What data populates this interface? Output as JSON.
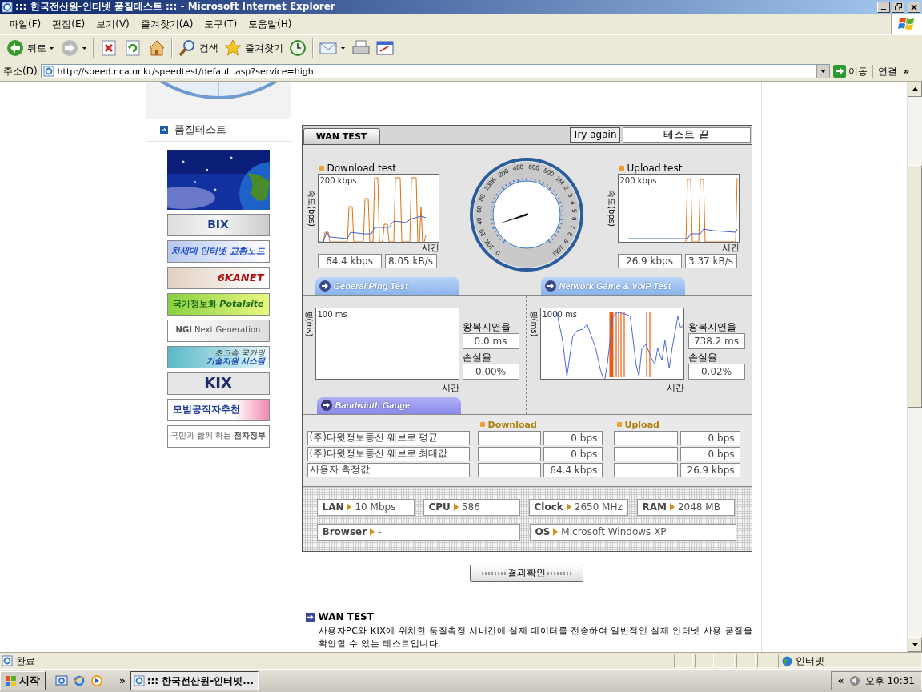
{
  "window": {
    "title": "::: 한국전산원-인터넷 품질테스트 ::: - Microsoft Internet Explorer"
  },
  "menu": [
    {
      "label": "파일(F)"
    },
    {
      "label": "편집(E)"
    },
    {
      "label": "보기(V)"
    },
    {
      "label": "즐겨찾기(A)"
    },
    {
      "label": "도구(T)"
    },
    {
      "label": "도움말(H)"
    }
  ],
  "toolbar": [
    [
      {
        "kind": "back",
        "label": "뒤로",
        "dropdown": true
      },
      {
        "kind": "forward",
        "dropdown": true
      }
    ],
    [
      {
        "kind": "stop",
        "dropdown": false
      },
      {
        "kind": "refresh",
        "dropdown": false
      },
      {
        "kind": "home",
        "dropdown": false
      }
    ],
    [
      {
        "kind": "search",
        "label": "검색",
        "dropdown": false
      },
      {
        "kind": "favorites",
        "label": "즐겨찾기",
        "dropdown": false
      },
      {
        "kind": "history",
        "dropdown": false
      }
    ],
    [
      {
        "kind": "mail",
        "dropdown": true
      },
      {
        "kind": "print",
        "dropdown": false
      },
      {
        "kind": "edit",
        "dropdown": false
      }
    ]
  ],
  "address_bar": {
    "label": "주소(D)",
    "url": "http://speed.nca.or.kr/speedtest/default.asp?service=high",
    "go": "이동",
    "links": "연결",
    "more": "»"
  },
  "sidebar": {
    "heading": "품질테스트",
    "banners": [
      {
        "kind": "picture"
      },
      {
        "kind": "banner",
        "lines": [
          "BIX"
        ]
      },
      {
        "kind": "banner",
        "lines": [
          "차세대 인터넷 교환노드"
        ]
      },
      {
        "kind": "banner",
        "lines": [
          "6KANET"
        ]
      },
      {
        "kind": "banner",
        "lines": [
          "국가정보화 *Potalsite*"
        ]
      },
      {
        "kind": "banner",
        "lines": [
          "**NGI** Next Generation"
        ]
      },
      {
        "kind": "banner",
        "lines": [
          "초고속 국가망",
          "기술지원 시스템"
        ]
      },
      {
        "kind": "banner",
        "lines": [
          "KIX"
        ]
      },
      {
        "kind": "banner",
        "lines": [
          "모범공직자추천"
        ]
      },
      {
        "kind": "banner",
        "lines": [
          "국민과 함께 하는 **전자정부**"
        ]
      }
    ]
  },
  "wan_test": {
    "tab": "WAN TEST",
    "try_again": "Try again",
    "status": "테스트 끝",
    "download": {
      "title": "Download test",
      "axis_label": "속도(bps)",
      "max_label": "200 kbps",
      "time_label": "시간",
      "readings": [
        "64.4 kbps",
        "8.05 kB/s"
      ]
    },
    "gauge": {
      "labels": [
        "0",
        "10K",
        "20",
        "40",
        "60",
        "80",
        "100K",
        "200",
        "400",
        "600",
        "800",
        "1M",
        "2",
        "3",
        "4",
        "5",
        "6",
        "7",
        "8",
        "9",
        "10M"
      ]
    },
    "upload": {
      "title": "Upload test",
      "axis_label": "속도(bps)",
      "max_label": "200 kbps",
      "time_label": "시간",
      "readings": [
        "26.9 kbps",
        "3.37 kB/s"
      ]
    },
    "section_tabs": [
      "General Ping Test",
      "Network Game & VoIP Test"
    ],
    "ping": {
      "axis_label": "핑(ms)",
      "max_label": "100 ms",
      "time_label": "시간",
      "delay_label": "왕복지연율",
      "delay": "0.0 ms",
      "loss_label": "손실율",
      "loss": "0.00%"
    },
    "voip": {
      "axis_label": "핑(ms)",
      "max_label": "1000 ms",
      "time_label": "시간",
      "delay_label": "왕복지연율",
      "delay": "738.2 ms",
      "loss_label": "손실율",
      "loss": "0.02%"
    },
    "bandwidth_tab": "Bandwidth Gauge",
    "bandwidth": {
      "columns": [
        "Download",
        "Upload"
      ],
      "rows": [
        {
          "label": "(주)다윗정보통신 웨브로 평균",
          "download": "0 bps",
          "upload": "0 bps"
        },
        {
          "label": "(주)다윗정보통신 웨브로 최대값",
          "download": "0 bps",
          "upload": "0 bps"
        },
        {
          "label": "사용자 측정값",
          "download": "64.4 kbps",
          "upload": "26.9 kbps"
        }
      ]
    },
    "system": [
      {
        "label": "LAN",
        "value": "10 Mbps"
      },
      {
        "label": "CPU",
        "value": "586"
      },
      {
        "label": "Clock",
        "value": "2650 MHz"
      },
      {
        "label": "RAM",
        "value": "2048 MB"
      },
      {
        "label": "Browser",
        "value": "-"
      },
      {
        "label": "OS",
        "value": "Microsoft Windows XP"
      }
    ]
  },
  "result_button": "결과확인",
  "description": {
    "title": "WAN TEST",
    "text": "사용자PC와 KIX에 위치한 품질측정 서버간에 실제 데이터를 전송하여 일반적인 실제 인터넷 사용 품질을 확인할 수 있는 테스트입니다."
  },
  "status_bar": {
    "text": "완료",
    "zone": "인터넷"
  },
  "taskbar": {
    "start": "시작",
    "more": "»",
    "task": "::: 한국전산원-인터넷...",
    "tray_more": "«",
    "clock": "오후 10:31"
  }
}
